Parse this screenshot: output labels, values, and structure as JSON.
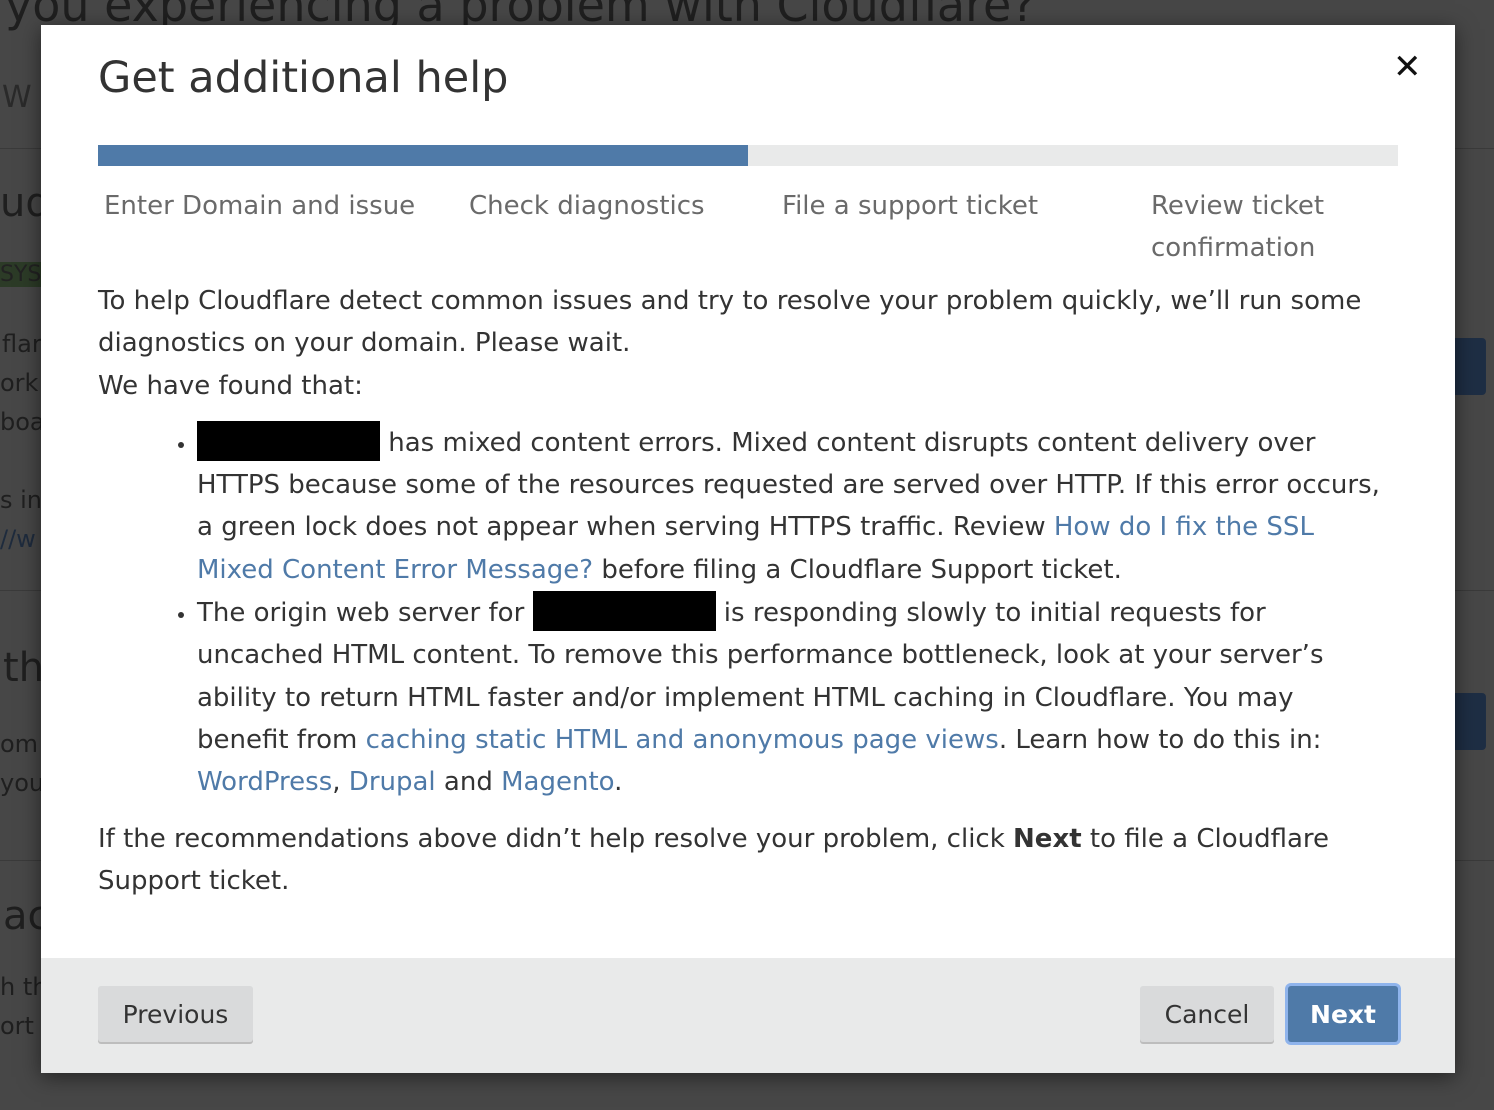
{
  "background": {
    "fragments": [
      "you experiencing a problem with Cloudflare?",
      "W",
      "udf",
      "SYST",
      "flar",
      "ork.",
      "boar",
      "s int",
      "//w",
      "th",
      "om",
      "your",
      "ac",
      "h th",
      "ort t"
    ]
  },
  "modal": {
    "title": "Get additional help",
    "close_icon": "close-icon",
    "progress_percent": 50,
    "progress_color": "#4f7aa8",
    "steps": [
      "Enter Domain and issue",
      "Check diagnostics",
      "File a support ticket",
      "Review ticket confirmation"
    ],
    "intro": "To help Cloudflare detect common issues and try to resolve your problem quickly, we’ll run some diagnostics on your domain. Please wait.",
    "found": "We have found that:",
    "item1": {
      "text_a": " has mixed content errors. Mixed content disrupts content delivery over HTTPS because some of the resources requested are served over HTTP. If this error occurs, a green lock does not appear when serving HTTPS traffic. Review ",
      "link": "How do I fix the SSL Mixed Content Error Message?",
      "text_b": " before filing a Cloudflare Support ticket."
    },
    "item2": {
      "text_a": "The origin web server for ",
      "text_b": " is responding slowly to initial requests for uncached HTML content. To remove this performance bottleneck, look at your server’s ability to return HTML faster and/or implement HTML caching in Cloudflare. You may benefit from ",
      "link_caching": "caching static HTML and anonymous page views",
      "text_c": ". Learn how to do this in: ",
      "link_wordpress": "WordPress",
      "sep": ", ",
      "link_drupal": "Drupal",
      "and": " and ",
      "link_magento": "Magento",
      "end": "."
    },
    "outro_a": "If the recommendations above didn’t help resolve your problem, click ",
    "outro_bold": "Next",
    "outro_b": " to file a Cloudflare Support ticket."
  },
  "footer": {
    "previous": "Previous",
    "cancel": "Cancel",
    "next": "Next"
  }
}
